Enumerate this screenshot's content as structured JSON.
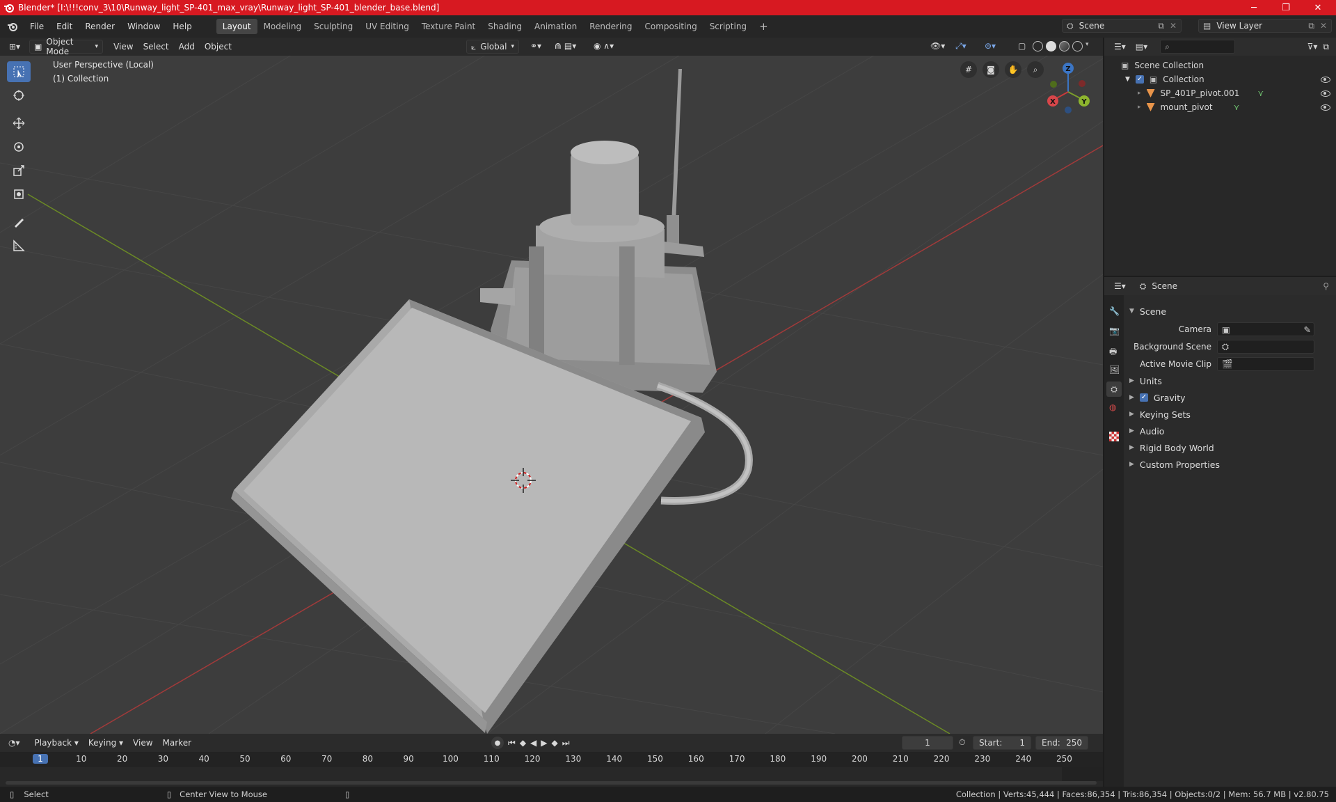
{
  "window": {
    "title": "Blender* [I:\\!!!conv_3\\10\\Runway_light_SP-401_max_vray\\Runway_light_SP-401_blender_base.blend]",
    "minimize_glyph": "─",
    "maximize_glyph": "❐",
    "close_glyph": "✕"
  },
  "menu": {
    "items": [
      "File",
      "Edit",
      "Render",
      "Window",
      "Help"
    ],
    "workspaces": [
      "Layout",
      "Modeling",
      "Sculpting",
      "UV Editing",
      "Texture Paint",
      "Shading",
      "Animation",
      "Rendering",
      "Compositing",
      "Scripting"
    ],
    "active_workspace": "Layout",
    "add_tab": "+",
    "scene_value": "Scene",
    "view_layer_value": "View Layer"
  },
  "viewport": {
    "mode": "Object Mode",
    "menus": [
      "View",
      "Select",
      "Add",
      "Object"
    ],
    "transform_orientation": "Global",
    "overlay_line1": "User Perspective (Local)",
    "overlay_line2": "(1) Collection",
    "gizmo_axes": [
      "Z",
      "Y",
      "X"
    ]
  },
  "outliner": {
    "root": "Scene Collection",
    "collection": "Collection",
    "objects": [
      "SP_401P_pivot.001",
      "mount_pivot"
    ]
  },
  "properties": {
    "header": "Scene",
    "section": "Scene",
    "fields": [
      {
        "label": "Camera"
      },
      {
        "label": "Background Scene"
      },
      {
        "label": "Active Movie Clip"
      }
    ],
    "subpanels": [
      "Units",
      "Gravity",
      "Keying Sets",
      "Audio",
      "Rigid Body World",
      "Custom Properties"
    ],
    "gravity_checked": true
  },
  "timeline": {
    "menus": [
      "Playback",
      "Keying",
      "View",
      "Marker"
    ],
    "current_frame": "1",
    "start_label": "Start:",
    "start_value": "1",
    "end_label": "End:",
    "end_value": "250",
    "ruler": [
      "1",
      "10",
      "20",
      "30",
      "40",
      "50",
      "60",
      "70",
      "80",
      "90",
      "100",
      "110",
      "120",
      "130",
      "140",
      "150",
      "160",
      "170",
      "180",
      "190",
      "200",
      "210",
      "220",
      "230",
      "240",
      "250"
    ]
  },
  "status": {
    "left": "Select",
    "middle": "Center View to Mouse",
    "right": "Collection | Verts:45,444 | Faces:86,354 | Tris:86,354 | Objects:0/2 | Mem: 56.7 MB | v2.80.75"
  },
  "colors": {
    "title_bar": "#d71921",
    "accent": "#4772b3",
    "x_axis": "#c83a3a",
    "y_axis": "#7b9d2b",
    "z_axis": "#3b75c4",
    "object_icon": "#e8944a"
  }
}
